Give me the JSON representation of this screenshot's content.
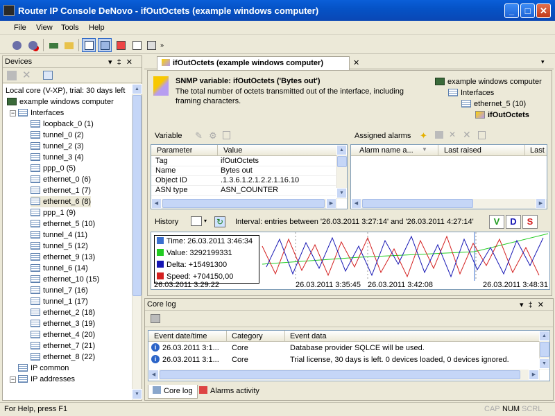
{
  "window": {
    "title": "Router IP Console DeNovo - ifOutOctets (example windows computer)",
    "min": "_",
    "max": "□",
    "close": "✕"
  },
  "menu": [
    "File",
    "View",
    "Tools",
    "Help"
  ],
  "devices_panel": {
    "title": "Devices",
    "pin": "▾ ‡ ✕",
    "core": "Local core (V-XP), trial: 30 days left",
    "computer": "example windows computer",
    "interfaces": "Interfaces",
    "items": [
      "loopback_0 (1)",
      "tunnel_0 (2)",
      "tunnel_2 (3)",
      "tunnel_3 (4)",
      "ppp_0 (5)",
      "ethernet_0 (6)",
      "ethernet_1 (7)",
      "ethernet_6 (8)",
      "ppp_1 (9)",
      "ethernet_5 (10)",
      "tunnel_4 (11)",
      "tunnel_5 (12)",
      "ethernet_9 (13)",
      "tunnel_6 (14)",
      "ethernet_10 (15)",
      "tunnel_7 (16)",
      "tunnel_1 (17)",
      "ethernet_2 (18)",
      "ethernet_3 (19)",
      "ethernet_4 (20)",
      "ethernet_7 (21)",
      "ethernet_8 (22)"
    ],
    "ip_common": "IP common",
    "ip_addresses": "IP addresses"
  },
  "doc": {
    "tab": "ifOutOctets (example windows computer)",
    "close": "✕",
    "heading": "SNMP variable: ifOutOctets ('Bytes out')",
    "desc1": "The total number of octets transmitted out of the interface, including",
    "desc2": "framing characters.",
    "path": [
      "example windows computer",
      "Interfaces",
      "ethernet_5 (10)",
      "ifOutOctets"
    ]
  },
  "variable": {
    "title": "Variable",
    "headers": [
      "Parameter",
      "Value"
    ],
    "rows": [
      [
        "Tag",
        "ifOutOctets"
      ],
      [
        "Name",
        "Bytes out"
      ],
      [
        "Object ID",
        ".1.3.6.1.2.1.2.2.1.16.10"
      ],
      [
        "ASN type",
        "ASN_COUNTER"
      ]
    ]
  },
  "alarms": {
    "title": "Assigned alarms",
    "headers": [
      "Alarm name a...",
      "Last raised",
      "Last"
    ]
  },
  "history": {
    "title": "History",
    "interval": "Interval: entries between '26.03.2011 3:27:14' and '26.03.2011 4:27:14'",
    "v": "V",
    "d": "D",
    "s": "S",
    "tooltip": [
      "Time: 26.03.2011 3:46:34",
      "Value: 3292199331",
      "Delta: +15491300",
      "Speed: +704150,00"
    ],
    "xlabels": [
      "26.03.2011 3:29:22",
      "26.03.2011 3:35:45",
      "26.03.2011 3:42:08",
      "26.03.2011 3:48:31"
    ],
    "colors": {
      "time": "#3a6fcf",
      "value": "#22cc22",
      "delta": "#1616b4",
      "speed": "#d42020"
    }
  },
  "corelog": {
    "title": "Core log",
    "headers": [
      "Event date/time",
      "Category",
      "Event data"
    ],
    "rows": [
      [
        "26.03.2011 3:1...",
        "Core",
        "Database provider SQLCE will be used."
      ],
      [
        "26.03.2011 3:1...",
        "Core",
        "Trial license, 30 days is left. 0 devices loaded, 0 devices ignored."
      ]
    ]
  },
  "bottom_tabs": [
    "Core log",
    "Alarms activity"
  ],
  "status": {
    "text": "For Help, press F1",
    "caps": "CAP",
    "num": "NUM",
    "scrl": "SCRL"
  }
}
